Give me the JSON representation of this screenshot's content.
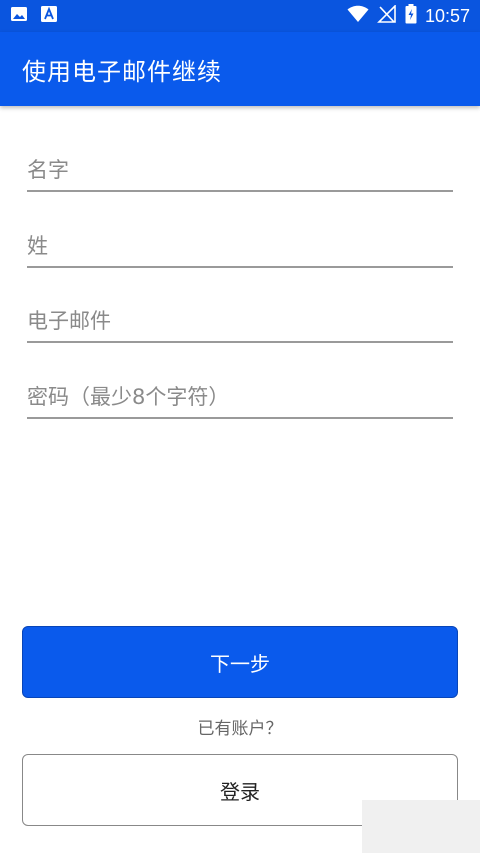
{
  "status_bar": {
    "time": "10:57",
    "left_icons": [
      "image-icon",
      "font-app-icon"
    ],
    "right_icons": [
      "wifi-icon",
      "signal-icon",
      "battery-icon"
    ]
  },
  "app_bar": {
    "title": "使用电子邮件继续"
  },
  "form": {
    "first_name_placeholder": "名字",
    "last_name_placeholder": "姓",
    "email_placeholder": "电子邮件",
    "password_placeholder": "密码（最少8个字符）"
  },
  "actions": {
    "next_label": "下一步",
    "have_account_text": "已有账户？",
    "login_label": "登录"
  },
  "colors": {
    "primary": "#0a5aec",
    "status_bar": "#0a55df"
  }
}
